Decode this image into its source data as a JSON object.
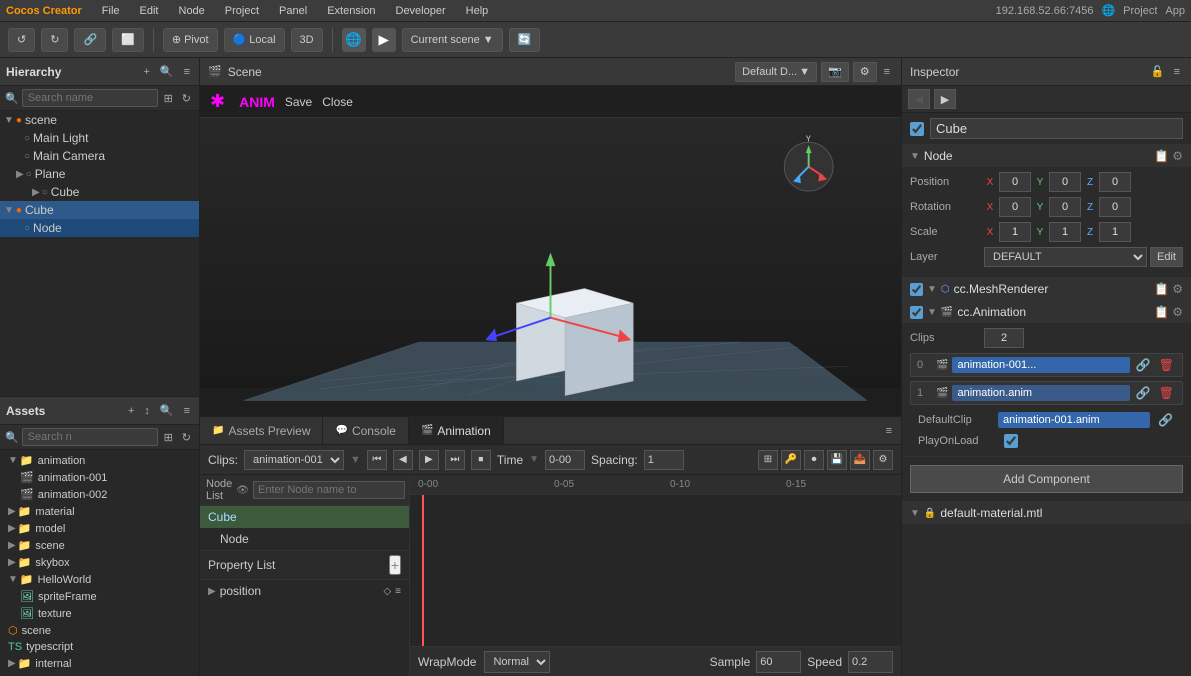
{
  "app": {
    "title": "Cocos Creator"
  },
  "menubar": {
    "items": [
      "File",
      "Edit",
      "Node",
      "Project",
      "Panel",
      "Extension",
      "Developer",
      "Help"
    ]
  },
  "toolbar": {
    "pivot_label": "Pivot",
    "local_label": "Local",
    "3d_label": "3D",
    "scene_label": "Current scene",
    "network": "192.168.52.66:7456",
    "project_label": "Project",
    "app_label": "App"
  },
  "hierarchy": {
    "title": "Hierarchy",
    "search_placeholder": "Search name",
    "items": [
      {
        "label": "scene",
        "indent": 0,
        "type": "scene",
        "expanded": true
      },
      {
        "label": "Main Light",
        "indent": 1,
        "type": "node"
      },
      {
        "label": "Main Camera",
        "indent": 1,
        "type": "node"
      },
      {
        "label": "Plane",
        "indent": 1,
        "type": "node",
        "expanded": true
      },
      {
        "label": "Cube",
        "indent": 2,
        "type": "node"
      },
      {
        "label": "Cube",
        "indent": 0,
        "type": "node",
        "expanded": true,
        "selected": true
      },
      {
        "label": "Node",
        "indent": 1,
        "type": "node"
      }
    ]
  },
  "assets": {
    "title": "Assets",
    "search_placeholder": "Search n",
    "items": [
      {
        "label": "animation",
        "type": "folder",
        "indent": 0
      },
      {
        "label": "animation-001",
        "type": "anim",
        "indent": 1
      },
      {
        "label": "animation-002",
        "type": "anim",
        "indent": 1
      },
      {
        "label": "material",
        "type": "folder",
        "indent": 0
      },
      {
        "label": "model",
        "type": "folder",
        "indent": 0
      },
      {
        "label": "scene",
        "type": "folder",
        "indent": 0
      },
      {
        "label": "skybox",
        "type": "folder",
        "indent": 0
      },
      {
        "label": "HelloWorld",
        "type": "folder",
        "indent": 0,
        "expanded": true
      },
      {
        "label": "spriteFrame",
        "type": "file",
        "indent": 1
      },
      {
        "label": "texture",
        "type": "file",
        "indent": 1
      },
      {
        "label": "scene",
        "type": "scene",
        "indent": 0
      },
      {
        "label": "typescript",
        "type": "ts",
        "indent": 0
      },
      {
        "label": "internal",
        "type": "folder",
        "indent": 0
      }
    ]
  },
  "scene": {
    "title": "Scene",
    "default_display": "Default D...",
    "anim_label": "ANIM",
    "save_label": "Save",
    "close_label": "Close"
  },
  "bottom_tabs": [
    {
      "label": "Assets Preview",
      "icon": "📁",
      "active": false
    },
    {
      "label": "Console",
      "icon": "💬",
      "active": false
    },
    {
      "label": "Animation",
      "icon": "🎬",
      "active": true
    }
  ],
  "animation": {
    "clips_label": "Clips:",
    "clip_name": "animation-001",
    "time_label": "Time",
    "time_value": "0-00",
    "spacing_label": "Spacing:",
    "spacing_value": "1",
    "node_list_label": "Node List",
    "node_enter_placeholder": "Enter Node name to",
    "nodes": [
      {
        "label": "Cube",
        "highlight": true
      },
      {
        "label": "Node",
        "highlight": false
      }
    ],
    "property_list_label": "Property List",
    "properties": [
      {
        "label": "position"
      }
    ],
    "wrapmode_label": "WrapMode",
    "wrapmode_value": "Normal",
    "sample_label": "Sample",
    "sample_value": "60",
    "speed_label": "Speed",
    "speed_value": "0.2",
    "timeline_marks": [
      "0-00",
      "0-05",
      "0-10",
      "0-15"
    ]
  },
  "inspector": {
    "title": "Inspector",
    "obj_name": "Cube",
    "obj_checked": true,
    "node": {
      "label": "Node",
      "position": {
        "x": "0",
        "y": "0",
        "z": "0"
      },
      "rotation": {
        "x": "0",
        "y": "0",
        "z": "0"
      },
      "scale": {
        "x": "1",
        "y": "1",
        "z": "1"
      },
      "layer": "DEFAULT",
      "edit_label": "Edit"
    },
    "mesh_renderer": {
      "label": "cc.MeshRenderer",
      "checked": true
    },
    "animation": {
      "label": "cc.Animation",
      "checked": true,
      "clips_count": "2",
      "clips": [
        {
          "index": "0",
          "name": "animation-001..."
        },
        {
          "index": "1",
          "name": "animation.anim"
        }
      ],
      "default_clip_label": "DefaultClip",
      "default_clip": "animation-001.anim",
      "play_on_load_label": "PlayOnLoad",
      "play_on_load": true
    },
    "add_component_label": "Add Component",
    "material": {
      "label": "default-material.mtl"
    }
  }
}
